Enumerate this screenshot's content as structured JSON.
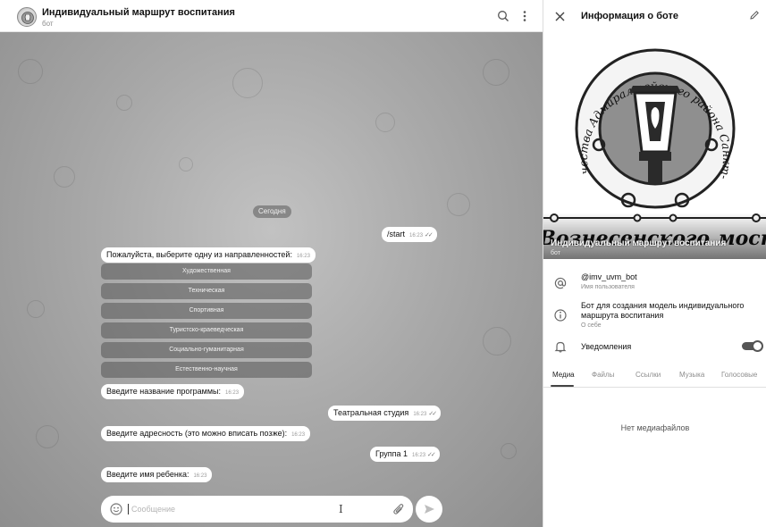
{
  "chat": {
    "title": "Индивидуальный маршрут воспитания",
    "subtitle": "бот",
    "date_separator": "Сегодня",
    "messages": [
      {
        "dir": "out",
        "text": "/start",
        "time": "16:23",
        "read": true
      },
      {
        "dir": "in",
        "text": "Пожалуйста, выберите одну из направленностей:",
        "time": "16:23"
      },
      {
        "dir": "in",
        "text": "Введите название программы:",
        "time": "16:23"
      },
      {
        "dir": "out",
        "text": "Театральная студия",
        "time": "16:23",
        "read": true
      },
      {
        "dir": "in",
        "text": "Введите адресность (это можно вписать позже):",
        "time": "16:23"
      },
      {
        "dir": "out",
        "text": "Группа 1",
        "time": "16:23",
        "read": true
      },
      {
        "dir": "in",
        "text": "Введите имя ребенка:",
        "time": "16:23"
      }
    ],
    "keyboard": [
      "Художественная",
      "Техническая",
      "Спортивная",
      "Туристско-краеведческая",
      "Социально-гуманитарная",
      "Естественно-научная"
    ],
    "composer": {
      "placeholder": "Сообщение",
      "value": ""
    }
  },
  "info": {
    "title": "Информация о боте",
    "cover": {
      "logo_text_arc": "Дворец творчества Адмиралтейского района Санкт-Петербурга",
      "logo_text_banner": "\"У Вознесенского моста\""
    },
    "name": "Индивидуальный маршрут воспитания",
    "subtitle": "бот",
    "username": "@imv_uvm_bot",
    "username_label": "Имя пользователя",
    "about_line1": "Бот для создания модель индивидуального",
    "about_line2": "маршрута воспитания",
    "about_label": "О себе",
    "notifications_label": "Уведомления",
    "notifications_on": true,
    "tabs": [
      "Медиа",
      "Файлы",
      "Ссылки",
      "Музыка",
      "Голосовые"
    ],
    "active_tab": "Медиа",
    "empty_text": "Нет медиафайлов"
  },
  "icons": {
    "header": [
      "search-icon",
      "more-vertical-icon"
    ],
    "composer": [
      "emoji-icon",
      "attach-icon",
      "send-icon"
    ],
    "info": [
      "close-icon",
      "edit-icon",
      "at-sign-icon",
      "info-icon",
      "bell-icon"
    ]
  }
}
